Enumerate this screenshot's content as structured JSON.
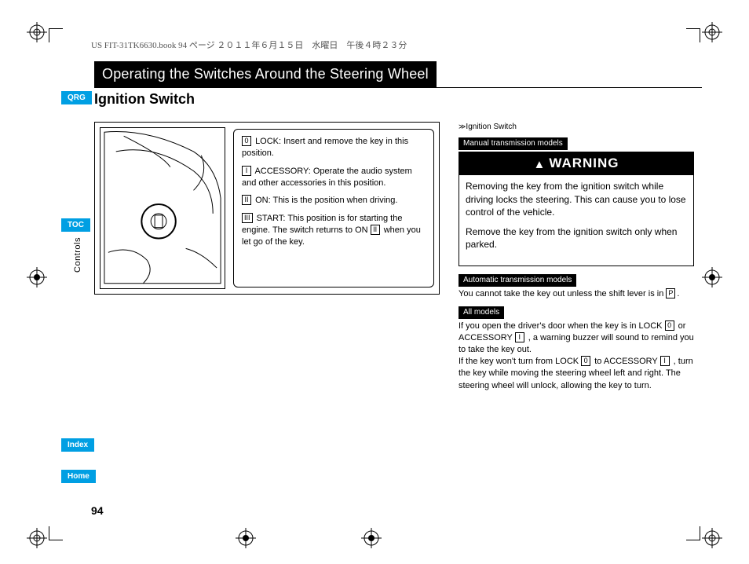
{
  "book_header": "US FIT-31TK6630.book  94 ページ  ２０１１年６月１５日　水曜日　午後４時２３分",
  "chapter_title": "Operating the Switches Around the Steering Wheel",
  "section_title": "Ignition Switch",
  "nav": {
    "qrg": "QRG",
    "toc": "TOC",
    "controls_tab": "Controls",
    "index": "Index",
    "home": "Home"
  },
  "page_number": "94",
  "ignition_positions": {
    "p0": {
      "key": "0",
      "label": "LOCK",
      "text": "LOCK: Insert and remove the key in this position."
    },
    "p1": {
      "key": "I",
      "label": "ACCESSORY",
      "text": "ACCESSORY: Operate the audio system and other accessories in this position."
    },
    "p2": {
      "key": "II",
      "label": "ON",
      "text": "ON: This is the position when driving."
    },
    "p3": {
      "key": "III",
      "label": "START",
      "text_a": "START: This position is for starting the engine. The switch returns to ON ",
      "key_ref": "II",
      "text_b": " when you let go of the key."
    }
  },
  "sidebar": {
    "heading": "Ignition Switch",
    "manual_tag": "Manual transmission models",
    "warning_title": "WARNING",
    "warning_p1": "Removing the key from the ignition switch while driving locks the steering. This can cause you to lose control of the vehicle.",
    "warning_p2": "Remove the key from the ignition switch only when parked.",
    "auto_tag": "Automatic transmission models",
    "auto_text_a": "You cannot take the key out unless the shift lever is in ",
    "auto_key": "P",
    "auto_text_b": ".",
    "all_tag": "All models",
    "all_p1_a": "If you open the driver's door when the key is in LOCK ",
    "all_k0": "0",
    "all_p1_b": " or ACCESSORY ",
    "all_k1": "I",
    "all_p1_c": ", a warning buzzer will sound to remind you to take the key out.",
    "all_p2_a": "If the key won't turn from LOCK ",
    "all_p2_b": " to ACCESSORY ",
    "all_p2_c": ", turn the key while moving the steering wheel left and right. The steering wheel will unlock, allowing the key to turn."
  }
}
